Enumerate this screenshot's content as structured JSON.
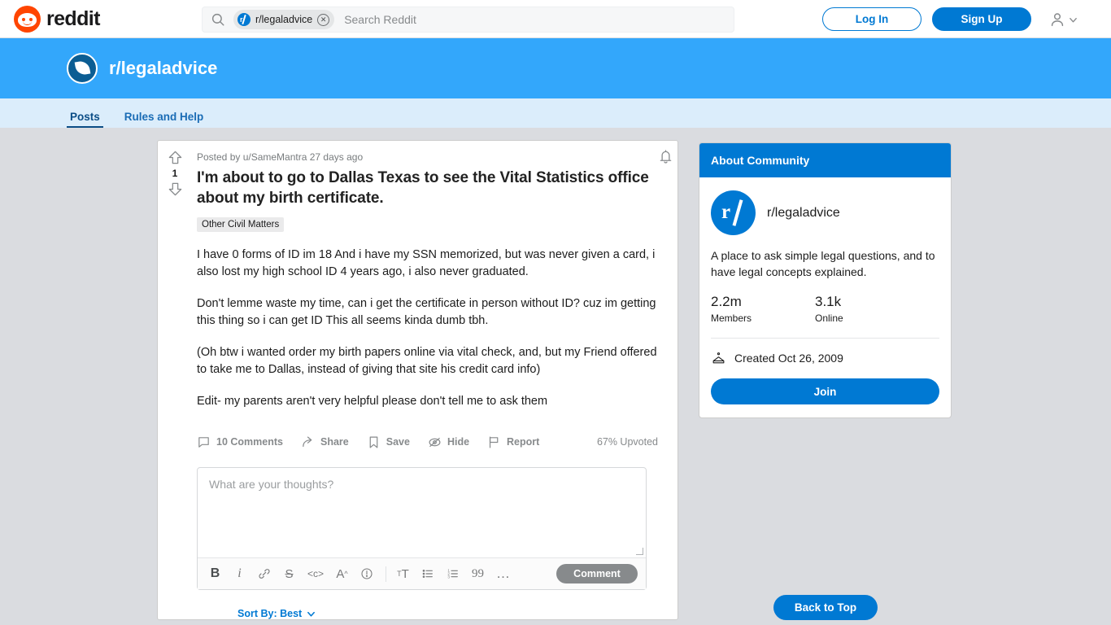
{
  "topnav": {
    "logo_text": "reddit",
    "search": {
      "chip_label": "r/legaladvice",
      "placeholder": "Search Reddit"
    },
    "login_label": "Log In",
    "signup_label": "Sign Up"
  },
  "banner": {
    "subreddit": "r/legaladvice"
  },
  "tabs": [
    {
      "label": "Posts",
      "active": true
    },
    {
      "label": "Rules and Help",
      "active": false
    }
  ],
  "post": {
    "meta": "Posted by u/SameMantra 27 days ago",
    "title": "I'm about to go to Dallas Texas to see the Vital Statistics office about my birth certificate.",
    "flair": "Other Civil Matters",
    "score": "1",
    "paragraphs": [
      "I have 0 forms of ID im 18 And i have my SSN memorized, but was never given a card, i also lost my high school ID 4 years ago, i also never graduated.",
      "Don't lemme waste my time, can i get the certificate in person without ID? cuz im getting this thing so i can get ID This all seems kinda dumb tbh.",
      "(Oh btw i wanted order my birth papers online via vital check, and, but my Friend offered to take me to Dallas, instead of giving that site his credit card info)",
      "Edit- my parents aren't very helpful please don't tell me to ask them"
    ],
    "actions": [
      {
        "label": "10 Comments",
        "icon": "comment-icon"
      },
      {
        "label": "Share",
        "icon": "share-icon"
      },
      {
        "label": "Save",
        "icon": "bookmark-icon"
      },
      {
        "label": "Hide",
        "icon": "hide-icon"
      },
      {
        "label": "Report",
        "icon": "flag-icon"
      }
    ],
    "upvoted_pct": "67% Upvoted"
  },
  "composer": {
    "placeholder": "What are your thoughts?",
    "value": "",
    "toolbar": [
      {
        "name": "bold-icon",
        "glyph": "B"
      },
      {
        "name": "italic-icon",
        "glyph": "i"
      },
      {
        "name": "link-icon",
        "glyph": "⊘"
      },
      {
        "name": "strikethrough-icon",
        "glyph": "S"
      },
      {
        "name": "inline-code-icon",
        "glyph": "<c>"
      },
      {
        "name": "superscript-icon",
        "glyph": "A"
      },
      {
        "name": "spoiler-icon",
        "glyph": "!"
      },
      {
        "name": "heading-icon",
        "glyph": "T"
      },
      {
        "name": "bulleted-list-icon",
        "glyph": "☰"
      },
      {
        "name": "numbered-list-icon",
        "glyph": "☰"
      },
      {
        "name": "quote-icon",
        "glyph": "99"
      },
      {
        "name": "more-options-icon",
        "glyph": "…"
      }
    ],
    "submit_label": "Comment"
  },
  "comments_sort": {
    "label": "Sort By: Best"
  },
  "sidebar": {
    "header": "About Community",
    "community_name": "r/legaladvice",
    "description": "A place to ask simple legal questions, and to have legal concepts explained.",
    "stats": [
      {
        "value": "2.2m",
        "label": "Members"
      },
      {
        "value": "3.1k",
        "label": "Online"
      }
    ],
    "created": "Created Oct 26, 2009",
    "join_label": "Join"
  },
  "back_to_top": {
    "label": "Back to Top"
  },
  "colors": {
    "reddit_orange": "#ff4500",
    "reddit_blue": "#0079d3",
    "banner_blue": "#33a7fb",
    "tabbar_blue": "#dbedfb",
    "page_bg": "#dadce0",
    "muted_text": "#878a8c"
  }
}
